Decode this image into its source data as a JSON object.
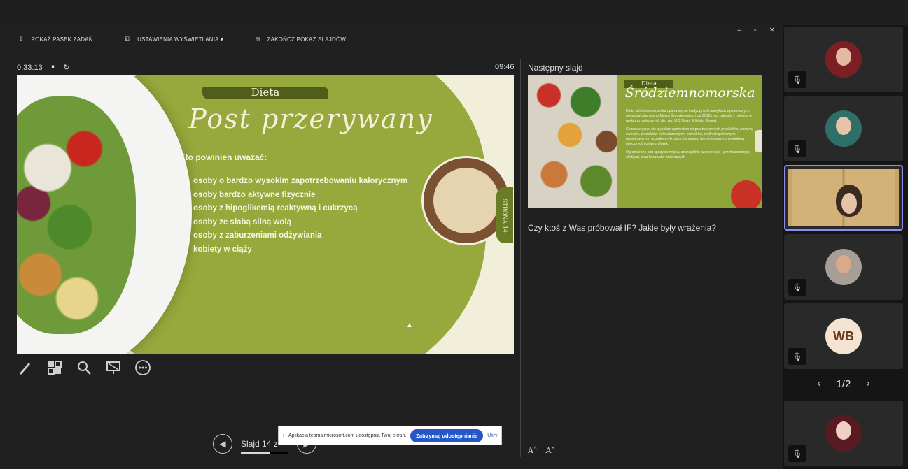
{
  "toolbar": {
    "taskbar": "POKAŻ PASEK ZADAŃ",
    "display_settings": "USTAWIENIA WYŚWIETLANIA ▾",
    "end_show": "ZAKOŃCZ POKAZ SLAJDÓW"
  },
  "window_controls": {
    "minimize": "–",
    "restore": "▫",
    "close": "✕"
  },
  "timer": {
    "elapsed": "0:33:13",
    "pause_icon": "⏸",
    "reset_icon": "↻",
    "clock": "09:46"
  },
  "current_slide": {
    "header_tag": "Dieta",
    "title": "Post przerywany",
    "subheading": "Kto powinien uważać:",
    "bullets": [
      "osoby o bardzo wysokim zapotrzebowaniu kalorycznym",
      "osoby bardzo aktywne fizycznie",
      "osoby z hipoglikemią reaktywną i cukrzycą",
      "osoby ze słabą silną wolą",
      "osoby z zaburzeniami odżywiania",
      "kobiety w ciąży"
    ],
    "page_tab": "STRONA 14"
  },
  "next_slide": {
    "label": "Następny slajd",
    "header_tag": "Dieta",
    "title": "Śródziemnomorska",
    "para1": "Dieta śródziemnomorska opiera się na tradycyjnych nawykach żywieniowych mieszkańców rejonu Morza Śródziemnego i od 2018 roku zajmuje 1 miejsce w rankingu najlepszych diet wg. U.S News & World Report.",
    "para2": "Charakteryzuje się wysokim spożyciem nieprzetworzonych produktów, warzyw, owoców, produktów pełnoziarnistych, orzechów, roślin strączkowych, umiarkowanym udziałem ryb, owoców morza, fermentowanych produktów mlecznych i oliwy z oliwek.",
    "para3": "Ograniczone jest spożycie mięsa, szczególnie czerwonego i przetworzonego, słodyczy oraz tłuszczów zwierzęcych"
  },
  "notes": "Czy ktoś z Was próbował IF? Jakie były wrażenia?",
  "font_controls": {
    "increase": "A˄",
    "decrease": "A˅"
  },
  "navigation": {
    "prev": "◀",
    "next": "▶",
    "slide_label": "Slajd 14 z",
    "progress": 0.6
  },
  "share_bar": {
    "message": "Aplikacja teams.microsoft.com udostępnia Twój ekran.",
    "stop_button": "Zatrzymaj udostępnianie",
    "hide_link": "Ukryj"
  },
  "participants": {
    "initials_tile": "WB",
    "mute_icon": "🎙",
    "pager": {
      "page": "1/2",
      "prev": "‹",
      "next": "›"
    }
  },
  "tools": [
    "pen-icon",
    "slide-grid-icon",
    "zoom-icon",
    "screen-icon",
    "more-icon"
  ]
}
